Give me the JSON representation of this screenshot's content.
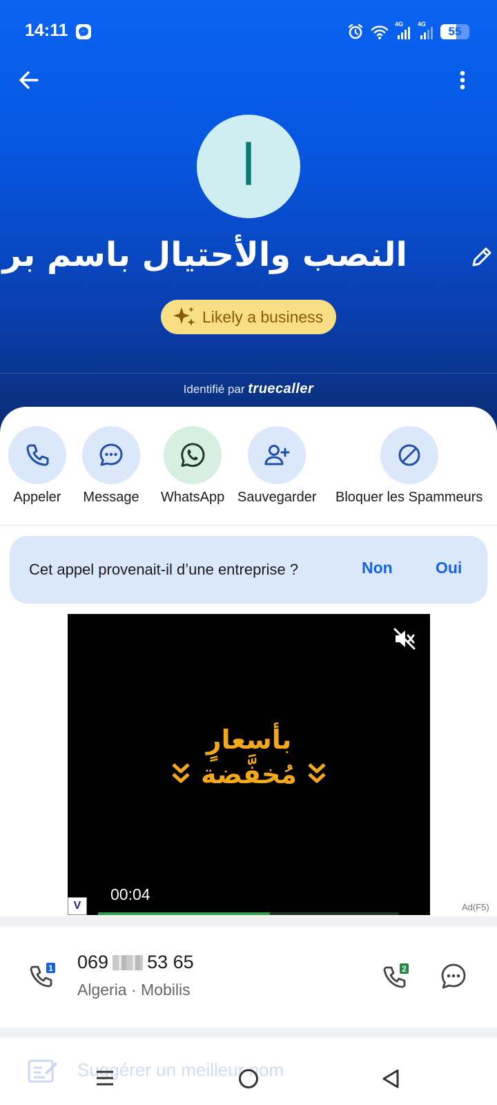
{
  "status_bar": {
    "time": "14:11",
    "network1": "4G",
    "network2": "4G",
    "battery": "55",
    "battery_level": 0.55
  },
  "contact": {
    "avatar_letter": "ا",
    "name": "النصب والأحتيال باسم بريد ا",
    "badge": "Likely a business",
    "identified_by": "Identifié par",
    "brand": "truecaller"
  },
  "actions": [
    {
      "label": "Appeler",
      "icon": "phone-icon"
    },
    {
      "label": "Message",
      "icon": "chat-bubble-icon"
    },
    {
      "label": "WhatsApp",
      "icon": "whatsapp-icon"
    },
    {
      "label": "Sauvegarder",
      "icon": "add-person-icon"
    },
    {
      "label": "Bloquer les Spammeurs",
      "icon": "block-icon"
    }
  ],
  "question": {
    "text": "Cet appel provenait-il d’une entreprise ?",
    "no": "Non",
    "yes": "Oui"
  },
  "ad": {
    "line1": "بأسعارٍ",
    "line2": "مُخفَّضة",
    "time": "00:04",
    "label": "Ad(F5)",
    "logo": "V",
    "progress": 0.57
  },
  "phone": {
    "number_start": "069",
    "number_end": "53 65",
    "sub": "Algeria · Mobilis",
    "sim1": "1",
    "sim2": "2"
  },
  "suggest": {
    "text": "Suggérer un meilleur nom"
  },
  "colors": {
    "header_blue": "#0a63f2",
    "accent": "#1563e0",
    "badge_yellow": "#f8df86",
    "ad_gold": "#f3a81c"
  }
}
